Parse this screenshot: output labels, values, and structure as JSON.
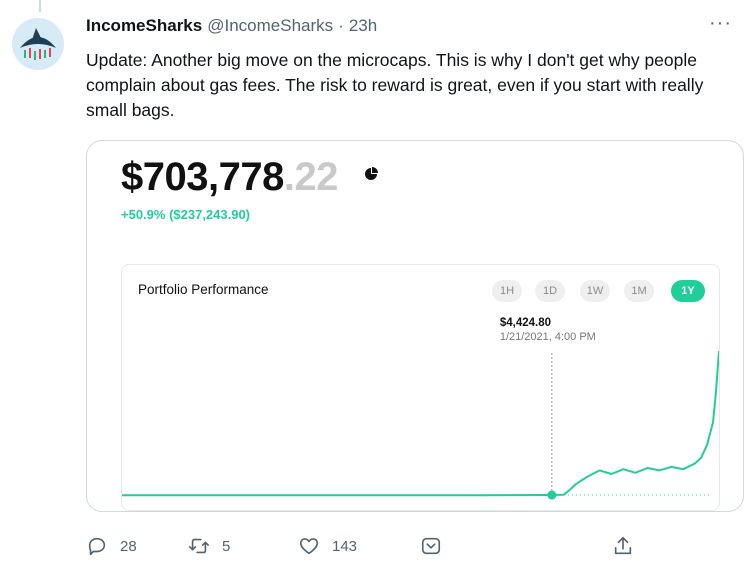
{
  "tweet": {
    "display_name": "IncomeSharks",
    "handle": "@IncomeSharks",
    "separator": "·",
    "time": "23h",
    "more_label": "···",
    "text": "Update: Another big move on the microcaps. This is why I don't get why people complain about gas fees. The risk to reward is great, even if you start with really small bags.",
    "avatar_icon": "shark-logo-icon"
  },
  "portfolio": {
    "balance_main": "$703,778",
    "balance_cents": ".22",
    "change": "+50.9% ($237,243.90)",
    "chart_title": "Portfolio Performance",
    "timeframes": [
      "1H",
      "1D",
      "1W",
      "1M",
      "1Y"
    ],
    "active_timeframe": "1Y",
    "hover_value": "$4,424.80",
    "hover_date": "1/21/2021, 4:00 PM",
    "accent_color": "#21ce99"
  },
  "chart_data": {
    "type": "line",
    "title": "Portfolio Performance",
    "xlabel": "",
    "ylabel": "",
    "x": [
      0,
      10,
      20,
      30,
      40,
      50,
      60,
      65,
      70,
      72,
      74,
      75,
      76,
      78,
      80,
      82,
      84,
      86,
      88,
      90,
      92,
      94,
      96,
      97,
      98,
      99,
      99.5,
      100
    ],
    "values": [
      4000,
      4000,
      4010,
      4020,
      4030,
      4040,
      4100,
      4300,
      4600,
      4424.8,
      5200,
      20000,
      40000,
      70000,
      95000,
      80000,
      100000,
      85000,
      105000,
      95000,
      110000,
      100000,
      125000,
      150000,
      210000,
      320000,
      480000,
      703778.22
    ],
    "highlight": {
      "value": 4424.8,
      "label": "1/21/2021, 4:00 PM"
    },
    "grid": false
  },
  "actions": {
    "reply": {
      "icon": "reply-icon",
      "count": "28"
    },
    "retweet": {
      "icon": "retweet-icon",
      "count": "5"
    },
    "like": {
      "icon": "heart-icon",
      "count": "143"
    },
    "tip": {
      "icon": "tip-icon"
    },
    "share": {
      "icon": "share-icon"
    }
  }
}
